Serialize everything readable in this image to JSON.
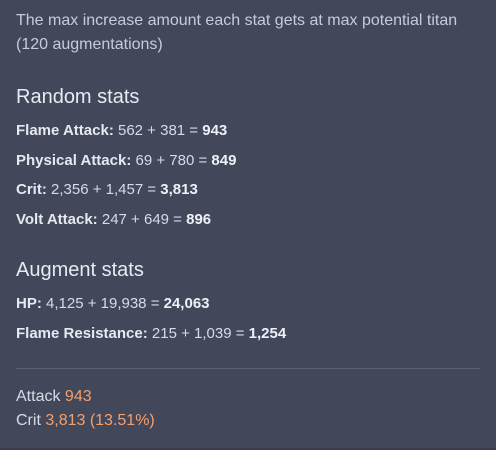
{
  "intro": "The max increase amount each stat gets at max potential titan (120 augmentations)",
  "random_stats": {
    "title": "Random stats",
    "items": [
      {
        "name": "Flame Attack:",
        "formula": "562 + 381 =",
        "total": "943"
      },
      {
        "name": "Physical Attack:",
        "formula": "69 + 780 =",
        "total": "849"
      },
      {
        "name": "Crit:",
        "formula": "2,356 + 1,457 =",
        "total": "3,813"
      },
      {
        "name": "Volt Attack:",
        "formula": "247 + 649 =",
        "total": "896"
      }
    ]
  },
  "augment_stats": {
    "title": "Augment stats",
    "items": [
      {
        "name": "HP:",
        "formula": "4,125 + 19,938 =",
        "total": "24,063"
      },
      {
        "name": "Flame Resistance:",
        "formula": "215 + 1,039 =",
        "total": "1,254"
      }
    ]
  },
  "summary": {
    "attack_label": "Attack",
    "attack_value": "943",
    "crit_label": "Crit",
    "crit_value": "3,813 (13.51%)"
  },
  "colors": {
    "background": "#43475a",
    "accent": "#f3a06e"
  }
}
